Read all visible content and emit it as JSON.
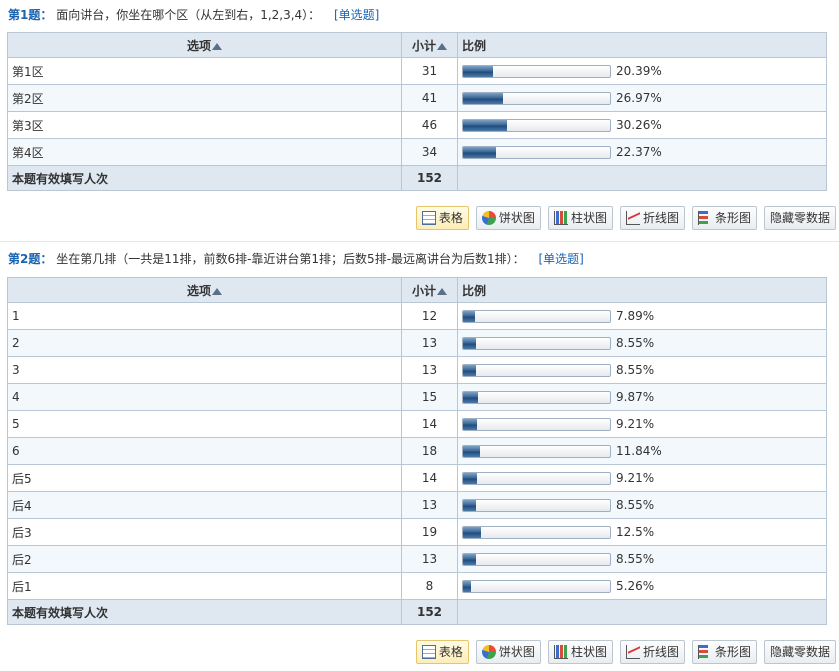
{
  "headers": {
    "option": "选项",
    "count": "小计",
    "ratio": "比例"
  },
  "questions": [
    {
      "num": "第1题：",
      "text": "面向讲台，你坐在哪个区（从左到右，1,2,3,4）：",
      "type": "[单选题]",
      "rows": [
        {
          "label": "第1区",
          "count": "31",
          "pct": "20.39%",
          "value": 20.39
        },
        {
          "label": "第2区",
          "count": "41",
          "pct": "26.97%",
          "value": 26.97
        },
        {
          "label": "第3区",
          "count": "46",
          "pct": "30.26%",
          "value": 30.26
        },
        {
          "label": "第4区",
          "count": "34",
          "pct": "22.37%",
          "value": 22.37
        }
      ],
      "total_label": "本题有效填写人次",
      "total": "152"
    },
    {
      "num": "第2题：",
      "text": "坐在第几排（一共是11排，前数6排-靠近讲台第1排；后数5排-最远离讲台为后数1排）：",
      "type": "[单选题]",
      "rows": [
        {
          "label": "1",
          "count": "12",
          "pct": "7.89%",
          "value": 7.89
        },
        {
          "label": "2",
          "count": "13",
          "pct": "8.55%",
          "value": 8.55
        },
        {
          "label": "3",
          "count": "13",
          "pct": "8.55%",
          "value": 8.55
        },
        {
          "label": "4",
          "count": "15",
          "pct": "9.87%",
          "value": 9.87
        },
        {
          "label": "5",
          "count": "14",
          "pct": "9.21%",
          "value": 9.21
        },
        {
          "label": "6",
          "count": "18",
          "pct": "11.84%",
          "value": 11.84
        },
        {
          "label": "后5",
          "count": "14",
          "pct": "9.21%",
          "value": 9.21
        },
        {
          "label": "后4",
          "count": "13",
          "pct": "8.55%",
          "value": 8.55
        },
        {
          "label": "后3",
          "count": "19",
          "pct": "12.5%",
          "value": 12.5
        },
        {
          "label": "后2",
          "count": "13",
          "pct": "8.55%",
          "value": 8.55
        },
        {
          "label": "后1",
          "count": "8",
          "pct": "5.26%",
          "value": 5.26
        }
      ],
      "total_label": "本题有效填写人次",
      "total": "152"
    }
  ],
  "toolbar": [
    {
      "label": "表格",
      "icon": "table-icon",
      "active": true
    },
    {
      "label": "饼状图",
      "icon": "pie-chart-icon",
      "active": false
    },
    {
      "label": "柱状图",
      "icon": "column-chart-icon",
      "active": false
    },
    {
      "label": "折线图",
      "icon": "line-chart-icon",
      "active": false
    },
    {
      "label": "条形图",
      "icon": "bar-chart-icon",
      "active": false
    },
    {
      "label": "隐藏零数据",
      "icon": "",
      "active": false
    }
  ],
  "colors": {
    "accent": "#1a64b0",
    "header_bg": "#dfe8f1",
    "border": "#b9c7d4",
    "row_alt": "#f3f8fc",
    "bar_fill": "#3b6795"
  }
}
